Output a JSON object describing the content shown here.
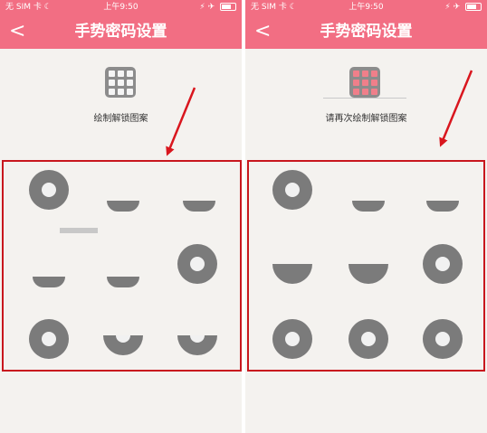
{
  "screens": [
    {
      "status": {
        "carrier": "无 SIM 卡 ☾",
        "time": "上午9:50",
        "right": "⚡ ✈"
      },
      "header": {
        "back_label": "<",
        "title": "手势密码设置"
      },
      "instruction": "绘制解锁图案"
    },
    {
      "status": {
        "carrier": "无 SIM 卡 ☾",
        "time": "上午9:50",
        "right": "⚡ ✈"
      },
      "header": {
        "back_label": "<",
        "title": "手势密码设置"
      },
      "instruction": "请再次绘制解锁图案"
    }
  ],
  "colors": {
    "header": "#f26e83",
    "highlight_border": "#c8171e",
    "arrow": "#d9161e",
    "dot": "#7b7b7b"
  },
  "icons": {
    "back": "chevron-left-icon",
    "grid": "grid-3x3-icon",
    "battery": "battery-icon",
    "arrow": "red-arrow-annotation"
  }
}
